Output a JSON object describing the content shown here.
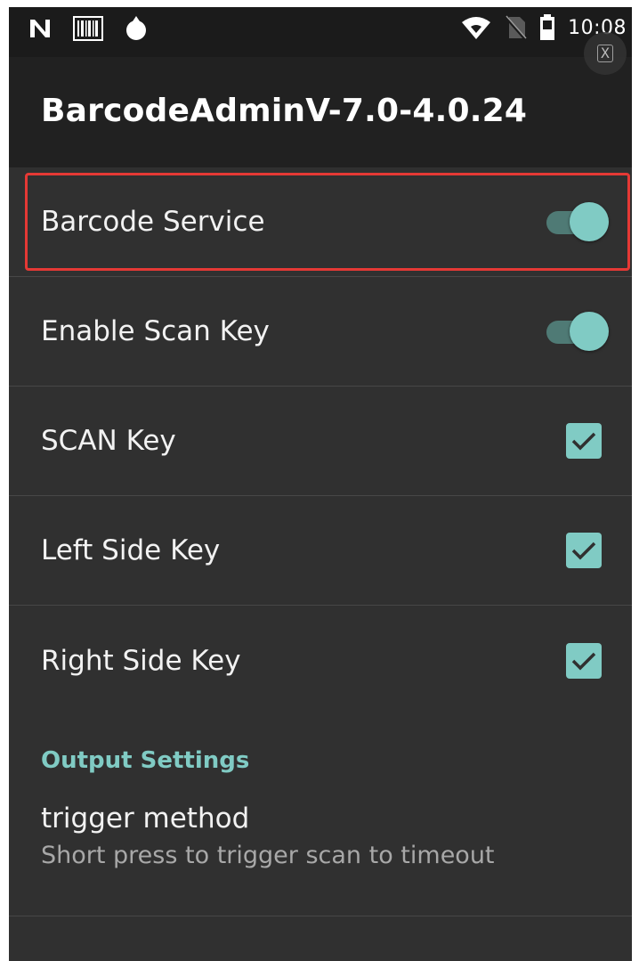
{
  "status_bar": {
    "time": "10:08",
    "left_icons": [
      "n-notification-icon",
      "barcode-icon",
      "drop-icon"
    ],
    "right_icons": [
      "wifi-icon",
      "no-sim-icon",
      "battery-icon"
    ],
    "overlay_icon": "screenshot-close-icon"
  },
  "app_bar": {
    "title": "BarcodeAdminV-7.0-4.0.24"
  },
  "preferences": {
    "barcode_service": {
      "label": "Barcode Service",
      "enabled": true,
      "highlighted": true
    },
    "enable_scan_key": {
      "label": "Enable Scan Key",
      "enabled": true
    },
    "scan_key": {
      "label": "SCAN Key",
      "checked": true
    },
    "left_side_key": {
      "label": "Left Side Key",
      "checked": true
    },
    "right_side_key": {
      "label": "Right Side Key",
      "checked": true
    }
  },
  "output_settings": {
    "header": "Output Settings",
    "trigger_method": {
      "title": "trigger method",
      "summary": "Short press to trigger scan to timeout"
    }
  },
  "colors": {
    "accent": "#80cbc4",
    "background": "#303030",
    "app_bar": "#212121",
    "highlight_border": "#e53935"
  }
}
